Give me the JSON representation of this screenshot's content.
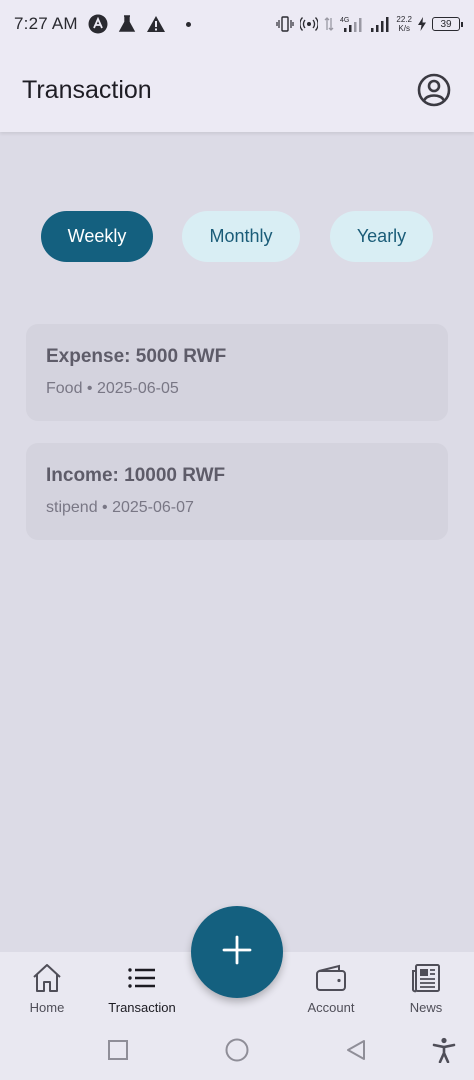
{
  "status_bar": {
    "time": "7:27 AM",
    "net_type": "4G",
    "speed_value": "22.2",
    "speed_unit": "K/s",
    "battery": "39"
  },
  "app_bar": {
    "title": "Transaction",
    "profile_icon": "account-circle-icon"
  },
  "period_tabs": [
    {
      "label": "Weekly",
      "active": true
    },
    {
      "label": "Monthly",
      "active": false
    },
    {
      "label": "Yearly",
      "active": false
    }
  ],
  "transactions": [
    {
      "title": "Expense: 5000 RWF",
      "subtitle": "Food • 2025-06-05"
    },
    {
      "title": "Income: 10000 RWF",
      "subtitle": "stipend • 2025-06-07"
    }
  ],
  "fab": {
    "icon": "plus-icon"
  },
  "bottom_nav": [
    {
      "label": "Home",
      "icon": "home-icon",
      "active": false
    },
    {
      "label": "Transaction",
      "icon": "list-icon",
      "active": true
    },
    {
      "label": "Account",
      "icon": "wallet-icon",
      "active": false
    },
    {
      "label": "News",
      "icon": "newspaper-icon",
      "active": false
    }
  ],
  "colors": {
    "primary": "#14607f",
    "tab_inactive_bg": "#d9eef4",
    "background": "#dcdbe6",
    "card": "#d4d3de"
  }
}
